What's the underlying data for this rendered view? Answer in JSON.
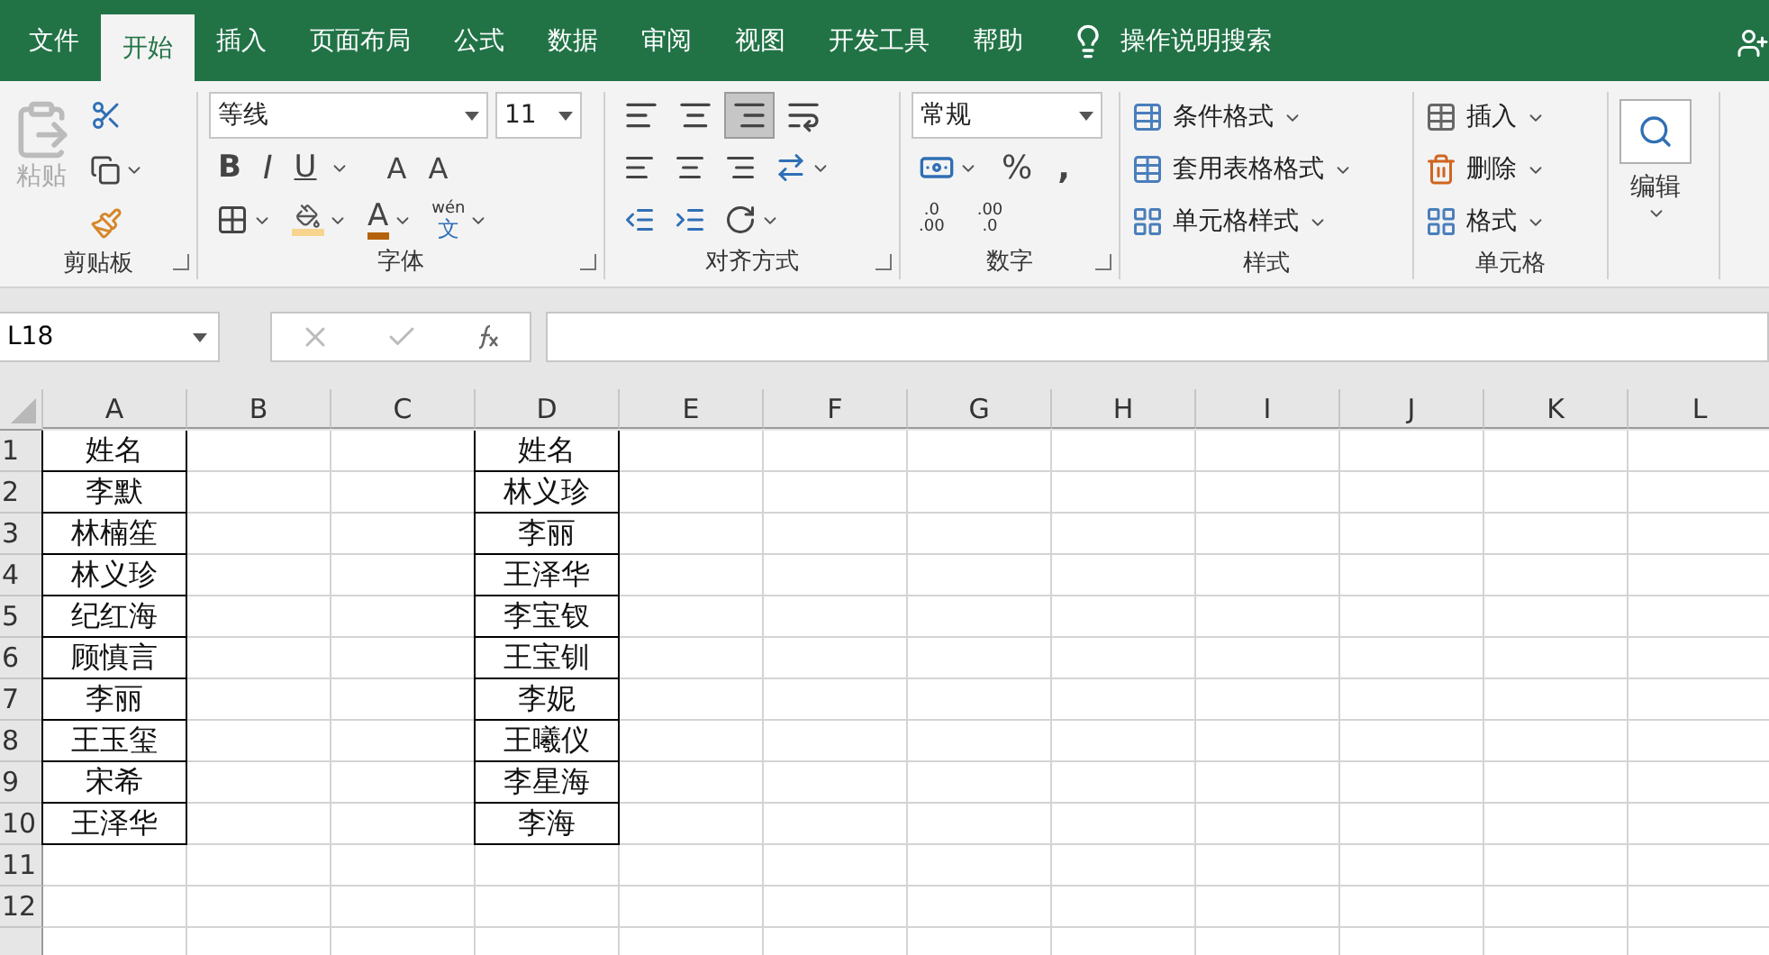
{
  "tabs": [
    {
      "label": "文件",
      "selected": false
    },
    {
      "label": "开始",
      "selected": true
    },
    {
      "label": "插入",
      "selected": false
    },
    {
      "label": "页面布局",
      "selected": false
    },
    {
      "label": "公式",
      "selected": false
    },
    {
      "label": "数据",
      "selected": false
    },
    {
      "label": "审阅",
      "selected": false
    },
    {
      "label": "视图",
      "selected": false
    },
    {
      "label": "开发工具",
      "selected": false
    },
    {
      "label": "帮助",
      "selected": false
    }
  ],
  "tell_me": {
    "label": "操作说明搜索"
  },
  "ribbon": {
    "clipboard": {
      "label": "剪贴板",
      "paste": {
        "label": "粘贴",
        "disabled": true
      }
    },
    "font": {
      "label": "字体",
      "font_name": "等线",
      "font_size": "11",
      "bold": "B",
      "italic": "I",
      "underline": "U",
      "grow": "A",
      "shrink": "A",
      "font_color": "A",
      "phonetic_top": "wén",
      "phonetic_bottom": "文"
    },
    "alignment": {
      "label": "对齐方式",
      "vertical": [
        {
          "selected": false
        },
        {
          "selected": false
        },
        {
          "selected": true
        }
      ]
    },
    "number": {
      "label": "数字",
      "format": "常规",
      "percent": "%",
      "comma": ",",
      "increase_decimal": [
        ".0",
        ".00"
      ],
      "decrease_decimal": [
        ".00",
        ".0"
      ]
    },
    "styles": {
      "label": "样式",
      "items": [
        {
          "kind": "conditional",
          "label": "条件格式"
        },
        {
          "kind": "table",
          "label": "套用表格格式"
        },
        {
          "kind": "cell",
          "label": "单元格样式"
        }
      ]
    },
    "cells": {
      "label": "单元格",
      "items": [
        {
          "kind": "insert",
          "label": "插入"
        },
        {
          "kind": "delete",
          "label": "删除"
        },
        {
          "kind": "format",
          "label": "格式"
        }
      ]
    },
    "editing": {
      "label": "编辑"
    }
  },
  "formula_bar": {
    "name_box": "L18"
  },
  "sheet": {
    "columns": [
      {
        "label": "A",
        "values": [
          "姓名",
          "李默",
          "林楠笙",
          "林义珍",
          "纪红海",
          "顾慎言",
          "李丽",
          "王玉玺",
          "宋希",
          "王泽华"
        ]
      },
      {
        "label": "B"
      },
      {
        "label": "C"
      },
      {
        "label": "D",
        "values": [
          "姓名",
          "林义珍",
          "李丽",
          "王泽华",
          "李宝钗",
          "王宝钏",
          "李妮",
          "王曦仪",
          "李星海",
          "李海"
        ]
      },
      {
        "label": "E"
      },
      {
        "label": "F"
      },
      {
        "label": "G"
      },
      {
        "label": "H"
      },
      {
        "label": "I"
      },
      {
        "label": "J"
      },
      {
        "label": "K"
      },
      {
        "label": "L"
      }
    ],
    "rows": [
      "1",
      "2",
      "3",
      "4",
      "5",
      "6",
      "7",
      "8",
      "9",
      "10",
      "11",
      "12"
    ]
  }
}
